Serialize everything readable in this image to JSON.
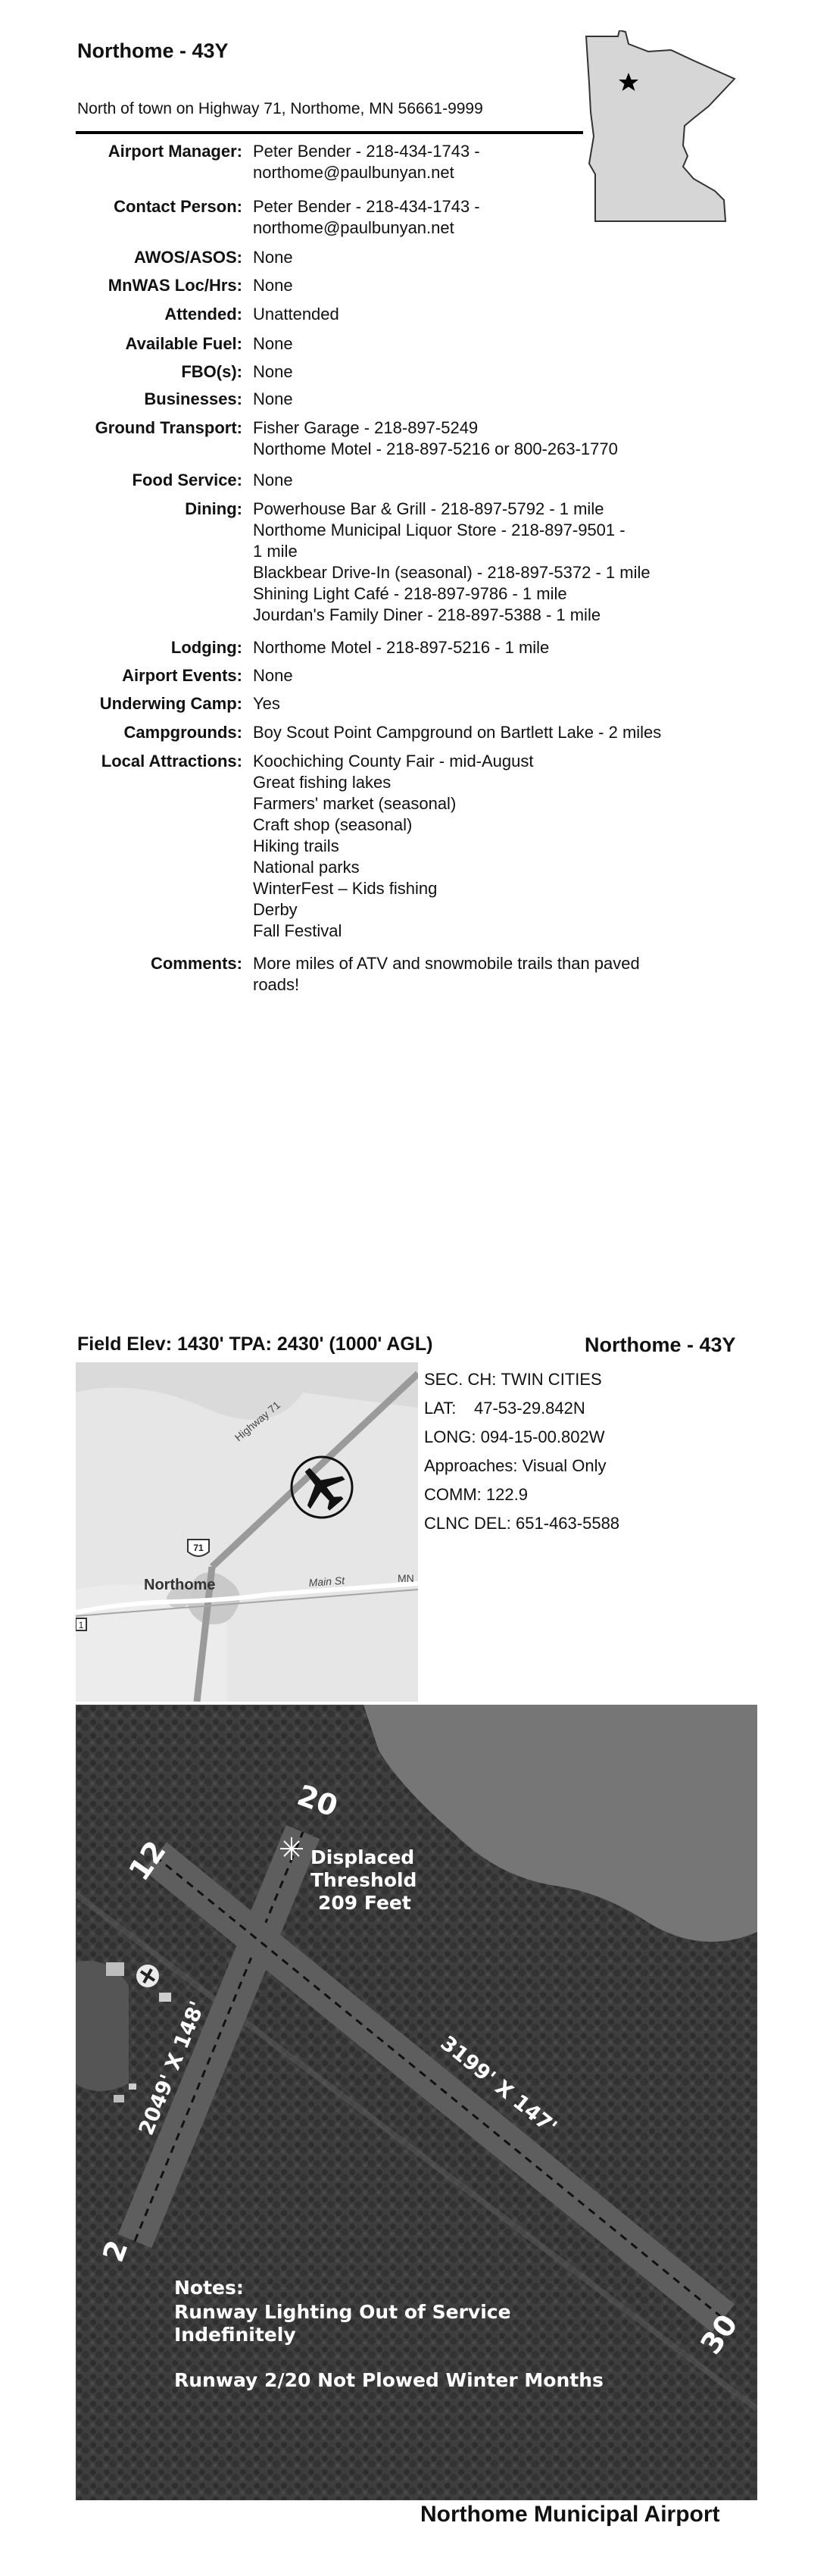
{
  "header": {
    "title": "Northome - 43Y",
    "address": "North of town on Highway 71, Northome, MN 56661-9999"
  },
  "rows": [
    {
      "label": "Airport Manager:",
      "lines": [
        " Peter Bender - 218-434-1743 -",
        "northome@paulbunyan.net"
      ]
    },
    {
      "label": "Contact Person:",
      "lines": [
        " Peter Bender - 218-434-1743 -",
        "northome@paulbunyan.net"
      ]
    },
    {
      "label": "AWOS/ASOS:",
      "lines": [
        "None"
      ]
    },
    {
      "label": "MnWAS Loc/Hrs:",
      "lines": [
        "None"
      ]
    },
    {
      "label": "Attended:",
      "lines": [
        "Unattended"
      ]
    },
    {
      "label": "Available Fuel:",
      "lines": [
        "None"
      ]
    },
    {
      "label": "FBO(s):",
      "lines": [
        "None"
      ]
    },
    {
      "label": "Businesses:",
      "lines": [
        "None"
      ]
    },
    {
      "label": "Ground Transport:",
      "lines": [
        "Fisher Garage - 218-897-5249",
        "Northome Motel - 218-897-5216 or 800-263-1770"
      ]
    },
    {
      "label": "Food Service:",
      "lines": [
        "None"
      ]
    },
    {
      "label": "Dining:",
      "lines": [
        "Powerhouse Bar & Grill  - 218-897-5792 - 1 mile",
        "Northome Municipal Liquor Store - 218-897-9501 -",
        " 1  mile",
        "Blackbear Drive-In (seasonal) - 218-897-5372 - 1 mile",
        "Shining Light Café - 218-897-9786 - 1 mile",
        "Jourdan's Family Diner - 218-897-5388 - 1 mile"
      ]
    },
    {
      "label": "Lodging:",
      "lines": [
        "Northome Motel - 218-897-5216 - 1 mile"
      ]
    },
    {
      "label": "Airport Events:",
      "lines": [
        "None"
      ]
    },
    {
      "label": "Underwing Camp:",
      "lines": [
        "Yes"
      ]
    },
    {
      "label": "Campgrounds:",
      "lines": [
        "Boy Scout Point Campground on Bartlett Lake - 2 miles"
      ]
    },
    {
      "label": "Local Attractions:",
      "lines": [
        "Koochiching County Fair - mid-August",
        "Great fishing lakes",
        "Farmers' market (seasonal)",
        "Craft shop (seasonal)",
        "Hiking trails",
        "National parks",
        "WinterFest – Kids fishing",
        "Derby",
        "Fall Festival"
      ]
    },
    {
      "label": "Comments:",
      "lines": [
        "More miles of ATV and snowmobile trails than paved",
        "roads!"
      ]
    }
  ],
  "page2": {
    "elev": "Field Elev: 1430'  TPA: 2430' (1000' AGL)",
    "title": "Northome - 43Y",
    "info": [
      {
        "label": "SEC. CH:",
        "value": "TWIN CITIES"
      },
      {
        "label": "LAT:",
        "value": "47-53-29.842N"
      },
      {
        "label": "LONG:",
        "value": "094-15-00.802W"
      },
      {
        "label": "",
        "value": "Approaches: Visual Only"
      },
      {
        "label": "",
        "value": "COMM: 122.9"
      },
      {
        "label": "",
        "value": "CLNC DEL: 651-463-5588"
      }
    ],
    "map": {
      "town": "Northome",
      "highway_label": "Highway 71",
      "shield": "71",
      "street": "Main St",
      "street_end": "MN",
      "shield_left": "1"
    },
    "aerial": {
      "runway_20": "20",
      "runway_12": "12",
      "runway_2": "2",
      "runway_30": "30",
      "displaced_1": "Displaced",
      "displaced_2": "Threshold",
      "displaced_3": "209 Feet",
      "dim_2_20": "2049' X 148'",
      "dim_12_30": "3199' X 147'",
      "notes_1": "Notes:",
      "notes_2": "Runway Lighting Out of Service",
      "notes_3": "Indefinitely",
      "notes_4": "Runway 2/20 Not Plowed Winter Months"
    },
    "caption": "Northome Municipal Airport"
  },
  "icons": [
    "star-icon",
    "airplane-icon",
    "highway-shield-icon",
    "beacon-icon"
  ]
}
